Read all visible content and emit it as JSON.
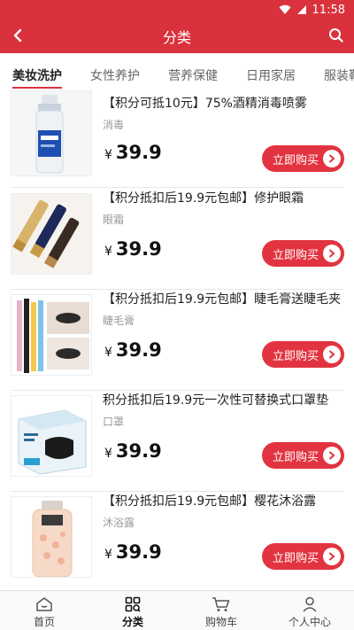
{
  "status": {
    "time": "11:58"
  },
  "appbar": {
    "title": "分类"
  },
  "tabs": [
    {
      "label": "美妆洗护",
      "active": true
    },
    {
      "label": "女性养护",
      "active": false
    },
    {
      "label": "营养保健",
      "active": false
    },
    {
      "label": "日用家居",
      "active": false
    },
    {
      "label": "服装鞋",
      "active": false
    }
  ],
  "products": [
    {
      "name": "【积分可抵10元】75%酒精消毒喷雾",
      "category": "消毒",
      "currency": "¥",
      "price": "39.9",
      "button": "立即购买"
    },
    {
      "name": "【积分抵扣后19.9元包邮】修护眼霜",
      "category": "眼霜",
      "currency": "¥",
      "price": "39.9",
      "button": "立即购买"
    },
    {
      "name": "【积分抵扣后19.9元包邮】睫毛膏送睫毛夹",
      "category": "睫毛膏",
      "currency": "¥",
      "price": "39.9",
      "button": "立即购买"
    },
    {
      "name": "积分抵扣后19.9元一次性可替换式口罩垫",
      "category": "口罩",
      "currency": "¥",
      "price": "39.9",
      "button": "立即购买"
    },
    {
      "name": "【积分抵扣后19.9元包邮】樱花沐浴露",
      "category": "沐浴露",
      "currency": "¥",
      "price": "39.9",
      "button": "立即购买"
    }
  ],
  "nav": [
    {
      "label": "首页",
      "icon": "home-icon",
      "active": false
    },
    {
      "label": "分类",
      "icon": "category-icon",
      "active": true
    },
    {
      "label": "购物车",
      "icon": "cart-icon",
      "active": false
    },
    {
      "label": "个人中心",
      "icon": "user-icon",
      "active": false
    }
  ],
  "colors": {
    "primary": "#d9323c",
    "button": "#e23440"
  }
}
